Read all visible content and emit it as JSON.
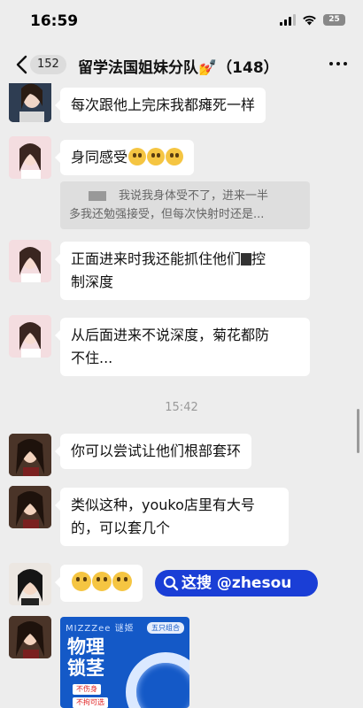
{
  "status_bar": {
    "time": "16:59",
    "battery": "25"
  },
  "nav": {
    "back_count": "152",
    "title": "留学法国姐妹分队💅（148）"
  },
  "messages": [
    {
      "text": "每次跟他上完床我都瘫死一样"
    },
    {
      "text": "身同感受"
    },
    {
      "quote_line1": "我说我身体受不了，进来一半",
      "quote_line2": "多我还勉强接受，但每次快射时还是..."
    },
    {
      "line1": "正面进来时我还能抓住他们",
      "line1_suffix": "控",
      "line2": "制深度"
    },
    {
      "line1": "从后面进来不说深度，菊花都防",
      "line2": "不住..."
    },
    {
      "timestamp": "15:42"
    },
    {
      "text": "你可以尝试让他们根部套环"
    },
    {
      "line1": "类似这种，youko店里有大号",
      "line2": "的，可以套几个"
    }
  ],
  "watermark": {
    "text": "这搜 @zhesou"
  },
  "ad": {
    "brand": "MIZZZee 谜姬",
    "tag": "五只组合",
    "title": "物理锁茎",
    "badge1": "不伤身",
    "badge2": "不拘可选"
  },
  "icons": {
    "back": "chevron-left-icon",
    "more": "more-dots-icon",
    "signal": "signal-icon",
    "wifi": "wifi-icon",
    "battery": "battery-icon",
    "search": "search-icon"
  },
  "colors": {
    "background": "#ededed",
    "bubble": "#ffffff",
    "watermark": "#1a3ed6",
    "ad": "#1459c7"
  }
}
